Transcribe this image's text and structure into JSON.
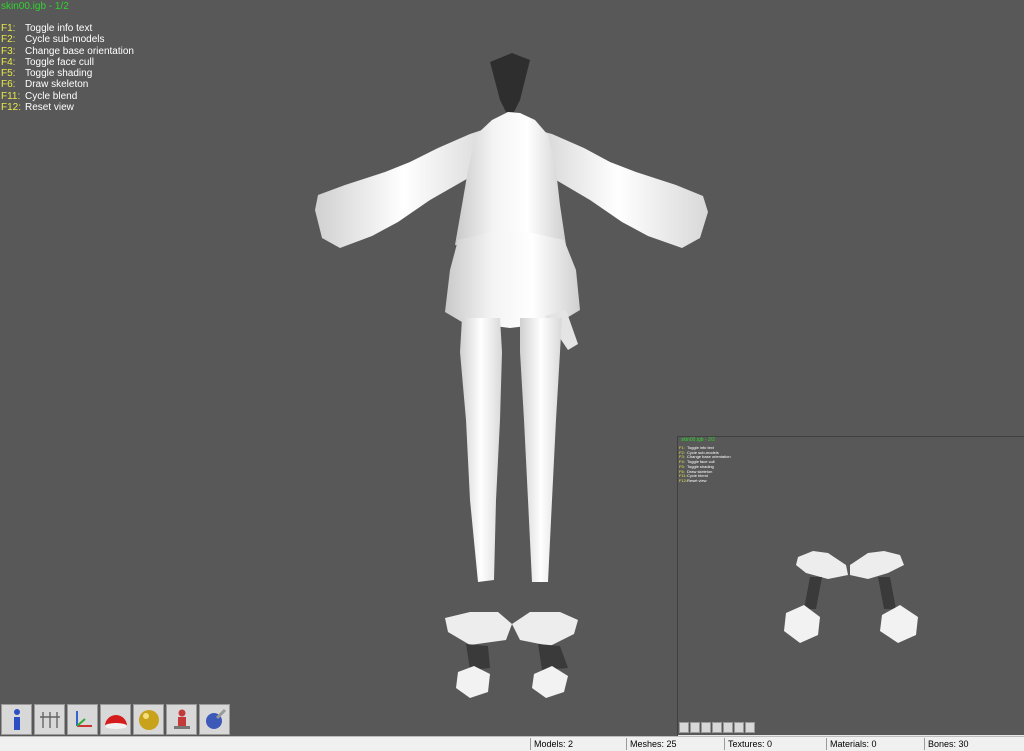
{
  "window": {
    "title": "skin00.igb - 1/2"
  },
  "help": [
    {
      "key": "F1:",
      "label": "Toggle info text"
    },
    {
      "key": "F2:",
      "label": "Cycle sub-models"
    },
    {
      "key": "F3:",
      "label": "Change base orientation"
    },
    {
      "key": "F4:",
      "label": "Toggle face cull"
    },
    {
      "key": "F5:",
      "label": "Toggle shading"
    },
    {
      "key": "F6:",
      "label": "Draw skeleton"
    },
    {
      "key": "F11:",
      "label": "Cycle blend"
    },
    {
      "key": "F12:",
      "label": "Reset view"
    }
  ],
  "toolbar": {
    "buttons": [
      "info-icon",
      "skeleton-figures-icon",
      "axes-icon",
      "red-dome-icon",
      "gold-sphere-icon",
      "bone-figure-icon",
      "globe-brush-icon"
    ]
  },
  "inset": {
    "title": "skin00.igb - 2/2",
    "help": [
      {
        "key": "F1:",
        "label": "Toggle info text"
      },
      {
        "key": "F2:",
        "label": "Cycle sub-models"
      },
      {
        "key": "F3:",
        "label": "Change base orientation"
      },
      {
        "key": "F4:",
        "label": "Toggle face cull"
      },
      {
        "key": "F5:",
        "label": "Toggle shading"
      },
      {
        "key": "F6:",
        "label": "Draw skeleton"
      },
      {
        "key": "F11:",
        "label": "Cycle blend"
      },
      {
        "key": "F12:",
        "label": "Reset view"
      }
    ],
    "status": {
      "models": "Models: 2",
      "meshes": "Meshes: 25",
      "textures": "Textures: 0",
      "materials": "Materials: 0",
      "bones": "Bones: 30"
    }
  },
  "status": {
    "models": "Models: 2",
    "meshes": "Meshes: 25",
    "textures": "Textures: 0",
    "materials": "Materials: 0",
    "bones": "Bones: 30"
  },
  "colors": {
    "background": "#585858",
    "title": "#2fd42f",
    "key": "#e8e84a",
    "text": "#ffffff",
    "statusbar": "#f0f0f0"
  }
}
